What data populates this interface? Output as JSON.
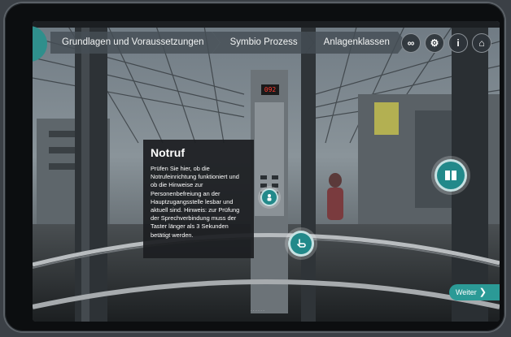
{
  "breadcrumb": {
    "items": [
      {
        "label": "Grundlagen und Voraussetzungen"
      },
      {
        "label": "Symbio Prozess"
      },
      {
        "label": "Anlagenklassen"
      }
    ]
  },
  "top_icons": [
    {
      "icon": "vr-goggles-icon",
      "glyph": "∞"
    },
    {
      "icon": "gyro-icon",
      "glyph": "⚙"
    },
    {
      "icon": "info-icon",
      "glyph": "i"
    },
    {
      "icon": "home-icon",
      "glyph": "⌂"
    }
  ],
  "tooltip": {
    "title": "Notruf",
    "body": "Prüfen Sie hier, ob die Notrufeinrichtung funktioniert und ob die Hinweise zur Personenbefreiung an der Hauptzugangsstelle lesbar und aktuell sind. Hinweis: zur Prüfung der Sprechverbindung muss der Taster länger als 3 Sekunden betätigt werden."
  },
  "floor_display": "092",
  "next_button": {
    "label": "Weiter",
    "arrow": "❯"
  },
  "colors": {
    "accent": "#2b9a96",
    "tooltip_bg": "#1c1e21",
    "display_red": "#ff3a2e"
  }
}
